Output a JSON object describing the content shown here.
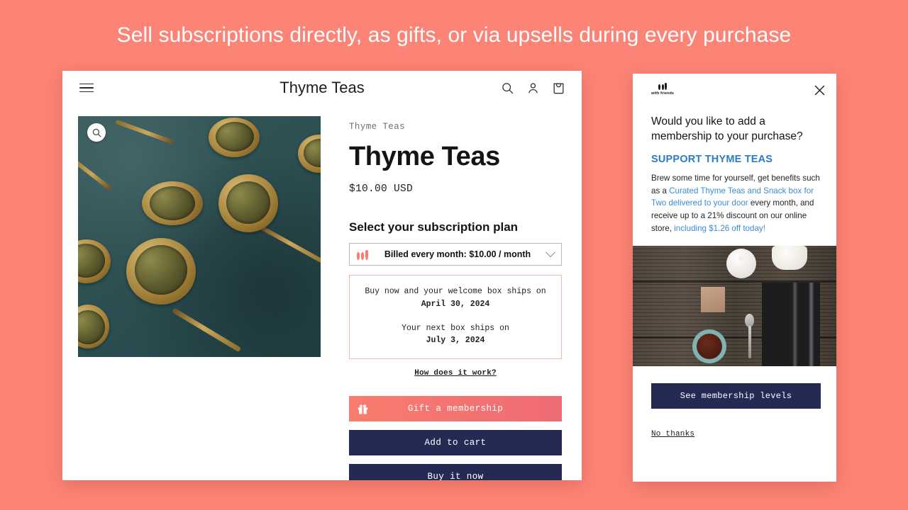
{
  "headline": "Sell subscriptions directly, as gifts, or via upsells during every purchase",
  "theme": {
    "background": "#FB8476",
    "navy": "#252A55",
    "coral": "#FB7A6B",
    "link_blue": "#3A8DD4",
    "heading_blue": "#2B7CC4",
    "ship_box_border": "#F5B6AC"
  },
  "store": {
    "header": {
      "menu_icon": "hamburger-icon",
      "title": "Thyme Teas",
      "icons": [
        "search-icon",
        "account-icon",
        "cart-icon"
      ]
    },
    "gallery": {
      "zoom_icon": "magnifier-icon",
      "image_alt": "Gold spoons filled with loose leaf tea on teal fabric"
    },
    "product": {
      "vendor": "Thyme Teas",
      "title": "Thyme Teas",
      "price": "$10.00 USD",
      "plan_label": "Select your subscription plan",
      "plan_selected": "Billed every month: $10.00 / month",
      "plan_logo": "with-friends-logo",
      "chevron": "chevron-down-icon"
    },
    "shipping": {
      "welcome_line": "Buy now and your welcome box ships on",
      "welcome_date": "April 30, 2024",
      "next_line": "Your next box ships on",
      "next_date": "July 3, 2024",
      "how_link": "How does it work?"
    },
    "actions": {
      "gift_icon": "gift-icon",
      "gift": "Gift a membership",
      "add_to_cart": "Add to cart",
      "buy_now": "Buy it now"
    }
  },
  "modal": {
    "logo_mark": "with-friends-logo",
    "logo_word": "with friends",
    "close_icon": "close-icon",
    "heading": "Would you like to add a membership to your purchase?",
    "subheading": "SUPPORT THYME TEAS",
    "body": {
      "part1": "Brew some time for yourself, get benefits such as a ",
      "link1": "Curated Thyme Teas and Snack box for Two delivered to your door",
      "part2": " every month, and receive up to a 21% discount on our online store, ",
      "link2": "including $1.26 off today!"
    },
    "image_alt": "Tea set flat lay on dark wood table",
    "cta": "See membership levels",
    "decline": "No thanks"
  }
}
